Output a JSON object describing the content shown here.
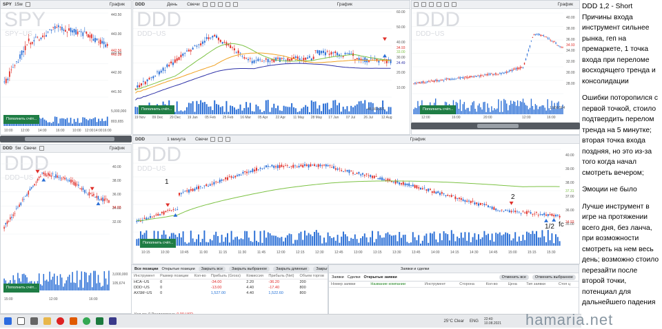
{
  "panels": {
    "spy": {
      "symbol": "SPY",
      "interval": "15м",
      "type": "",
      "graph": "График",
      "watermark": "SPY",
      "watermark_sub": "SPY~US",
      "prices": [
        "443.50",
        "443.00",
        "442.50",
        "442.00",
        "441.50"
      ],
      "price_tags": [
        "442.56",
        "442.39"
      ],
      "vol": [
        "5,000,000",
        "803,655"
      ],
      "times": [
        "10:00",
        "12:00",
        "14:00",
        "16:00",
        "10:00",
        "12:00",
        "14:00",
        "16:00"
      ],
      "button": "Пополнить счёт..."
    },
    "ddd_day": {
      "symbol": "DDD",
      "interval": "День",
      "type": "Свечи",
      "graph": "График",
      "watermark": "DDD",
      "watermark_sub": "DDD~US",
      "prices": [
        "60.00",
        "50.00",
        "40.00",
        "30.00",
        "20.00",
        "10.00"
      ],
      "price_tags": [
        "34.93",
        "33.00",
        "24.49"
      ],
      "vol": [
        "40,563,271"
      ],
      "times": [
        "19 Nov",
        "09 Dec",
        "29 Dec",
        "19 Jan",
        "05 Feb",
        "25 Feb",
        "16 Mar",
        "05 Apr",
        "22 Apr",
        "11 May",
        "28 May",
        "17 Jun",
        "07 Jul",
        "26 Jul",
        "12 Aug"
      ],
      "button": "Пополнить счёт..."
    },
    "ddd_ext": {
      "graph": "График",
      "watermark": "DDD",
      "watermark_sub": "DDD~US",
      "prices": [
        "40.00",
        "38.00",
        "36.00",
        "34.00",
        "32.00",
        "30.00",
        "28.00"
      ],
      "price_tags": [
        "34.93"
      ],
      "vol": [
        "1,550,564"
      ],
      "times": [
        "12:00",
        "16:00",
        "20:00",
        "12:00",
        "16:00"
      ],
      "button": "Пополнить счёт..."
    },
    "ddd_5m": {
      "symbol": "DDD",
      "interval": "5м",
      "type": "Свечи",
      "graph": "График",
      "watermark": "DDD",
      "watermark_sub": "DDD~US",
      "prices": [
        "40.00",
        "38.00",
        "36.00",
        "34.00",
        "32.00"
      ],
      "price_tags": [
        "34.93"
      ],
      "vol": [
        "3,000,000",
        "105,674"
      ],
      "times": [
        "15:00",
        "12:00",
        "16:00"
      ],
      "button": "Пополнить счёт..."
    },
    "ddd_1m": {
      "symbol": "DDD",
      "interval": "1 минута",
      "type": "Свечи",
      "graph": "График",
      "watermark": "DDD",
      "watermark_sub": "DDD~US",
      "prices": [
        "40.00",
        "39.00",
        "38.00",
        "37.00",
        "36.00",
        "35.00"
      ],
      "price_tags": [
        "37.31",
        "34.93"
      ],
      "times": [
        "10:15",
        "10:30",
        "10:45",
        "11:00",
        "11:15",
        "11:30",
        "11:45",
        "12:00",
        "12:15",
        "12:30",
        "12:45",
        "13:00",
        "13:15",
        "13:30",
        "13:45",
        "14:00",
        "14:15",
        "14:30",
        "14:45",
        "15:00",
        "15:15",
        "15:30"
      ],
      "annotations": [
        "1",
        "2",
        "1/2",
        "fc"
      ],
      "button": "Пополнить счёт..."
    }
  },
  "positions": {
    "tabs": [
      "Все позиции",
      "Открытые позиции"
    ],
    "buttons": [
      "Закрыть все",
      "Закрыть выбранное",
      "Закрыть длинные",
      "Закрыть короткие"
    ],
    "headers": [
      "Инструмент",
      "Размер позиции",
      "Кол-во",
      "Прибыль (Gross)",
      "Комиссия",
      "Прибыль (Net)",
      "Объем торгов"
    ],
    "rows": [
      [
        "HCA~US",
        "0",
        "",
        "-34.00",
        "2.20",
        "-36.20",
        "200"
      ],
      [
        "DDD~US",
        "0",
        "",
        "-13.00",
        "4.40",
        "-17.40",
        "800"
      ],
      [
        "AXSM~US",
        "0",
        "",
        "1,527.00",
        "4.40",
        "1,522.60",
        "800"
      ]
    ],
    "footer_label": "Кол-во:",
    "footer_qty": "0",
    "footer_realized_label": "Реализовано:",
    "footer_realized": "0.00 USD"
  },
  "orders": {
    "title": "Заявки и сделки",
    "tabs": [
      "Заявки",
      "Сделки",
      "Открытые заявки"
    ],
    "buttons": [
      "Отменить все",
      "Отменить выбранное"
    ],
    "headers": [
      "Номер заявки",
      "Название компании",
      "Инструмент",
      "Сторона",
      "Кол-во",
      "Цена",
      "Тип заявки",
      "Стоп ц"
    ]
  },
  "notes": {
    "p1": "DDD 1,2 - Short Причины входа инструмент сильнее рынка, геп на премаркете, 1 точка входа при переломе восходящего тренда и консолидации",
    "p2": "Ошибки поторопился с первой точкой, стоило подтвердить перелом тренда на 5 минутке; вторая точка входа поздняя, но это из-за того когда начал смотреть вечером;",
    "p3": "Эмоции не было",
    "p4": "Лучше инструмент в игре на протяжении всего дня, без ланча, при возможности смотреть на нем весь день; возможно стоило перезайти после второй точки, потенциал для дальнейшего падения"
  },
  "taskbar": {
    "weather": "25°C  Clear",
    "lang": "ENG",
    "time": "22:40",
    "date": "10.08.2021"
  },
  "watermark": "hamaria.net",
  "colors": {
    "up": "#2b6fd6",
    "down": "#e0302a",
    "ma_green": "#7cc243",
    "ma_orange": "#f0a020",
    "ma_navy": "#2b2fa6",
    "volume": "#2b6fd6"
  }
}
